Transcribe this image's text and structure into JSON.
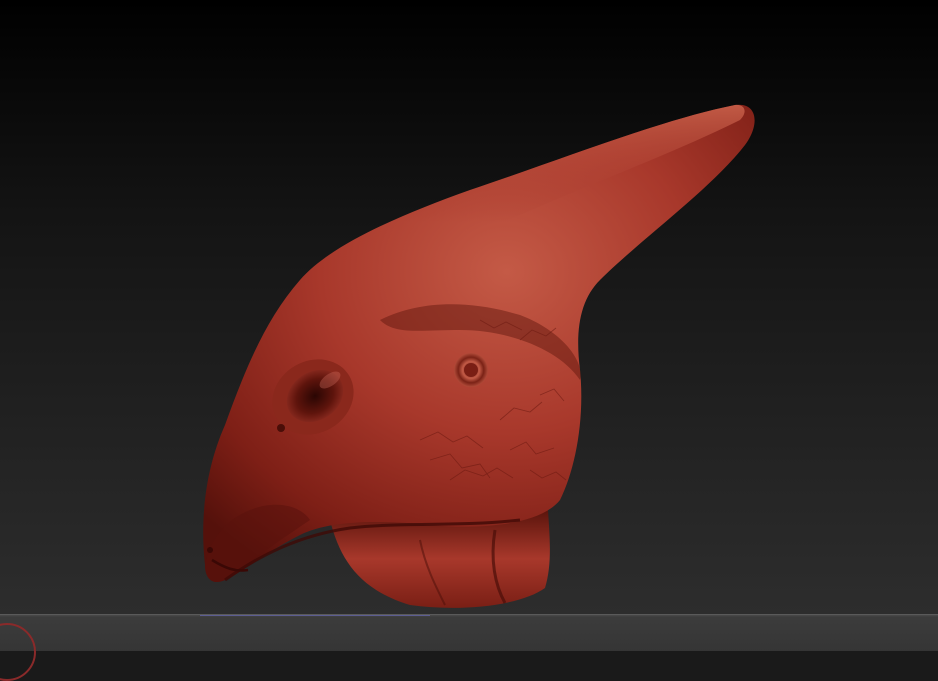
{
  "app": {
    "view": "3d-sculpt-viewport"
  },
  "model": {
    "material": "red-wax",
    "subject": "creature-head-sculpt",
    "colors": {
      "base": "#a8362a",
      "light": "#d06a56",
      "shadow": "#5a130d",
      "deep": "#3a0a06"
    }
  },
  "background": {
    "top": "#000000",
    "bottom": "#2b2b2b"
  },
  "bottom_shelf": {
    "color": "#3c3c3c",
    "accent": "#6a6cc4"
  },
  "gizmo": {
    "icon": "navigation-gizmo-icon",
    "color": "#8a2a2a"
  }
}
